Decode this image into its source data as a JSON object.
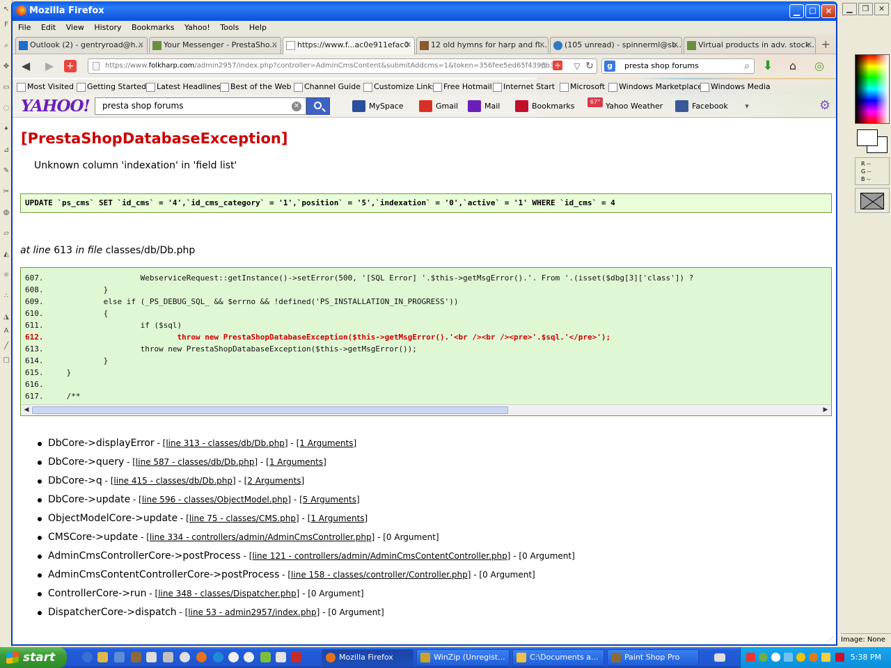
{
  "window": {
    "title": "Mozilla Firefox"
  },
  "menu": [
    "File",
    "Edit",
    "View",
    "History",
    "Bookmarks",
    "Yahoo!",
    "Tools",
    "Help"
  ],
  "tabs": [
    {
      "label": "Outlook (2) - gentryroad@h...",
      "icon_color": "#1c6ec9",
      "active": false
    },
    {
      "label": "Your Messenger - PrestaSho...",
      "icon_color": "#6a8e3a",
      "active": false
    },
    {
      "label": "https://www.f...ac0e911efac0",
      "icon_color": "#ffffff",
      "active": true
    },
    {
      "label": "12 old hymns for harp and fl...",
      "icon_color": "#8a5a2b",
      "active": false
    },
    {
      "label": "(105 unread) - spinnerml@sb...",
      "icon_color": "#2f78c4",
      "active": false
    },
    {
      "label": "Virtual products in adv. stock...",
      "icon_color": "#6a8e3a",
      "active": false
    }
  ],
  "nav": {
    "url_prefix": "https://www.",
    "url_domain": "folkharp.com",
    "url_rest": "/admin2957/index.php?controller=AdminCmsContent&submitAddcms=1&token=356fee5ed65f4398b3",
    "search_value": "presta shop forums"
  },
  "bookmarks": [
    "Most Visited",
    "Getting Started",
    "Latest Headlines",
    "Best of the Web",
    "Channel Guide",
    "Customize Links",
    "Free Hotmail",
    "Internet Start",
    "Microsoft",
    "Windows Marketplace",
    "Windows Media"
  ],
  "yahoo": {
    "logo": "YAHOO!",
    "search_value": "presta shop forums",
    "items": [
      {
        "label": "MySpace",
        "color": "#2b4f9a"
      },
      {
        "label": "Gmail",
        "color": "#d93025"
      },
      {
        "label": "Mail",
        "color": "#6a1fb8"
      },
      {
        "label": "Bookmarks",
        "color": "#c0102a"
      },
      {
        "label": "Yahoo Weather",
        "color": "#d93a4a"
      },
      {
        "label": "Facebook",
        "color": "#3b5998"
      }
    ],
    "weather_badge": "67°"
  },
  "error": {
    "title": "[PrestaShopDatabaseException]",
    "message": "Unknown column 'indexation' in 'field list'",
    "sql": "UPDATE `ps_cms` SET `id_cms` = '4',`id_cms_category` = '1',`position` = '5',`indexation` = '0',`active` = '1' WHERE `id_cms` = 4",
    "at_prefix": "at line",
    "line_number": "613",
    "in_file_text": "in file",
    "file": "classes/db/Db.php"
  },
  "code_lines": [
    {
      "num": "607.",
      "code": "                    WebserviceRequest::getInstance()->setError(500, '[SQL Error] '.$this->getMsgError().'. From '.(isset($dbg[3]['class']) ?",
      "highlight": false
    },
    {
      "num": "608.",
      "code": "            }",
      "highlight": false
    },
    {
      "num": "609.",
      "code": "            else if (_PS_DEBUG_SQL_ && $errno && !defined('PS_INSTALLATION_IN_PROGRESS'))",
      "highlight": false
    },
    {
      "num": "610.",
      "code": "            {",
      "highlight": false
    },
    {
      "num": "611.",
      "code": "                    if ($sql)",
      "highlight": false
    },
    {
      "num": "612.",
      "code": "                            throw new PrestaShopDatabaseException($this->getMsgError().'<br /><br /><pre>'.$sql.'</pre>');",
      "highlight": true
    },
    {
      "num": "613.",
      "code": "                    throw new PrestaShopDatabaseException($this->getMsgError());",
      "highlight": false
    },
    {
      "num": "614.",
      "code": "            }",
      "highlight": false
    },
    {
      "num": "615.",
      "code": "    }",
      "highlight": false
    },
    {
      "num": "616.",
      "code": "",
      "highlight": false
    },
    {
      "num": "617.",
      "code": "    /**",
      "highlight": false
    }
  ],
  "trace": [
    {
      "fn": "DbCore->displayError",
      "loc": "[line 313 - classes/db/Db.php]",
      "args": "[1 Arguments]",
      "args_link": true
    },
    {
      "fn": "DbCore->query",
      "loc": "[line 587 - classes/db/Db.php]",
      "args": "[1 Arguments]",
      "args_link": true
    },
    {
      "fn": "DbCore->q",
      "loc": "[line 415 - classes/db/Db.php]",
      "args": "[2 Arguments]",
      "args_link": true
    },
    {
      "fn": "DbCore->update",
      "loc": "[line 596 - classes/ObjectModel.php]",
      "args": "[5 Arguments]",
      "args_link": true
    },
    {
      "fn": "ObjectModelCore->update",
      "loc": "[line 75 - classes/CMS.php]",
      "args": "[1 Arguments]",
      "args_link": true
    },
    {
      "fn": "CMSCore->update",
      "loc": "[line 334 - controllers/admin/AdminCmsController.php]",
      "args": "[0 Argument]",
      "args_link": false
    },
    {
      "fn": "AdminCmsControllerCore->postProcess",
      "loc": "[line 121 - controllers/admin/AdminCmsContentController.php]",
      "args": "[0 Argument]",
      "args_link": false
    },
    {
      "fn": "AdminCmsContentControllerCore->postProcess",
      "loc": "[line 158 - classes/controller/Controller.php]",
      "args": "[0 Argument]",
      "args_link": false
    },
    {
      "fn": "ControllerCore->run",
      "loc": "[line 348 - classes/Dispatcher.php]",
      "args": "[0 Argument]",
      "args_link": false
    },
    {
      "fn": "DispatcherCore->dispatch",
      "loc": "[line 53 - admin2957/index.php]",
      "args": "[0 Argument]",
      "args_link": false
    }
  ],
  "psp": {
    "rgb": [
      "R --",
      "G --",
      "B --"
    ],
    "image_status": "Image: None"
  },
  "taskbar": {
    "start": "start",
    "tasks": [
      {
        "label": "Mozilla Firefox",
        "icon_color": "#e5731a",
        "active": true
      },
      {
        "label": "WinZip (Unregist...",
        "icon_color": "#c9a227",
        "active": false
      },
      {
        "label": "C:\\Documents a...",
        "icon_color": "#f0c040",
        "active": false
      },
      {
        "label": "Paint Shop Pro",
        "icon_color": "#8a6a3a",
        "active": false
      }
    ],
    "clock": "5:38 PM"
  }
}
